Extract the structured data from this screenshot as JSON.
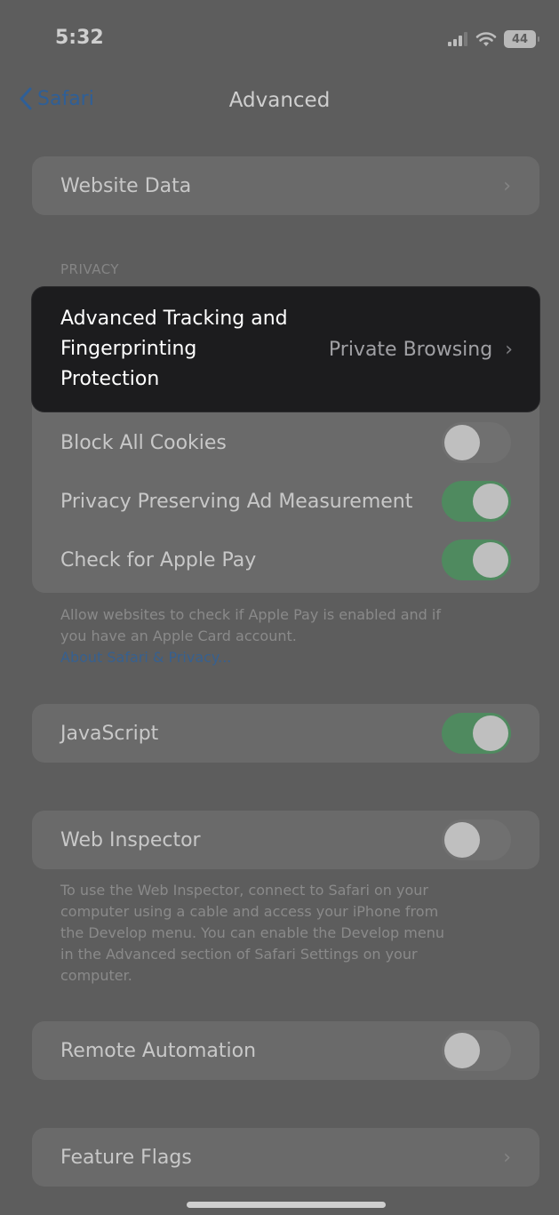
{
  "status_bar": {
    "time": "5:32",
    "battery": "44",
    "icons": [
      "cellular-signal-icon",
      "wifi-icon",
      "battery-icon"
    ]
  },
  "nav": {
    "back_label": "Safari",
    "title": "Advanced"
  },
  "website_data": {
    "label": "Website Data"
  },
  "privacy": {
    "header": "PRIVACY",
    "tracking": {
      "label_line1": "Advanced Tracking and",
      "label_line2": "Fingerprinting",
      "label_line3": "Protection",
      "value": "Private Browsing"
    },
    "block_cookies": {
      "label": "Block All Cookies",
      "on": false
    },
    "ad_measurement": {
      "label": "Privacy Preserving Ad Measurement",
      "on": true
    },
    "apple_pay": {
      "label": "Check for Apple Pay",
      "on": true
    },
    "footer_line1": "Allow websites to check if Apple Pay is enabled and if",
    "footer_line2": "you have an Apple Card account.",
    "footer_link": "About Safari & Privacy..."
  },
  "javascript": {
    "label": "JavaScript",
    "on": true
  },
  "web_inspector": {
    "label": "Web Inspector",
    "on": false,
    "footer_line1": "To use the Web Inspector, connect to Safari on your",
    "footer_line2": "computer using a cable and access your iPhone from",
    "footer_line3": "the Develop menu. You can enable the Develop menu",
    "footer_line4": "in the Advanced section of Safari Settings on your",
    "footer_line5": "computer."
  },
  "remote_automation": {
    "label": "Remote Automation",
    "on": false
  },
  "feature_flags": {
    "label": "Feature Flags"
  },
  "colors": {
    "accent_blue": "#2f5f97",
    "toggle_on": "#4f8a5f",
    "highlight_bg": "#1c1c1e"
  }
}
